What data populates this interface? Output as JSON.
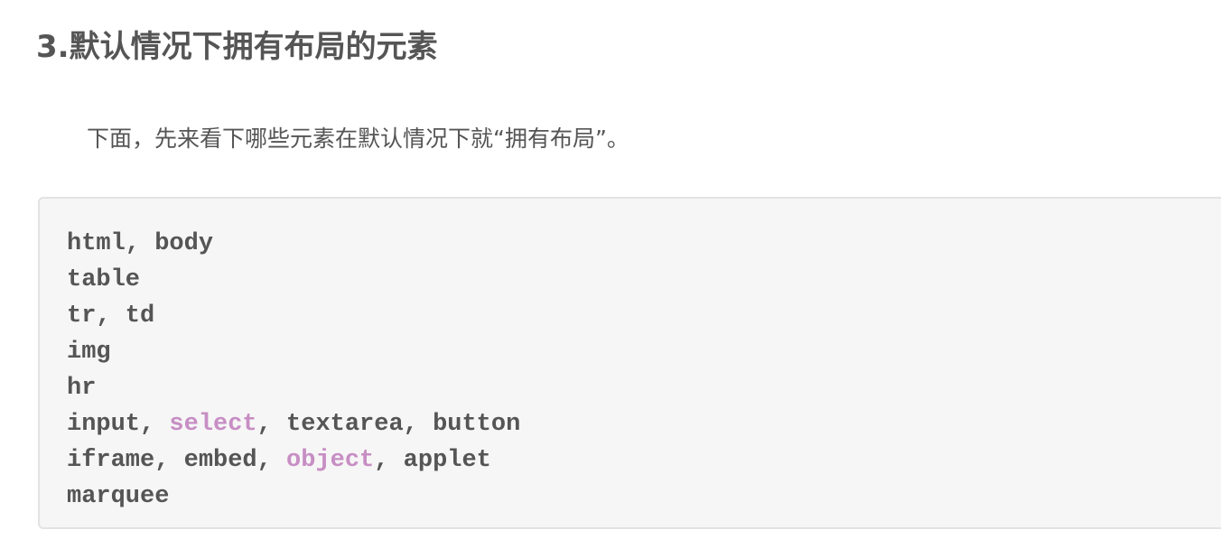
{
  "heading": "3.默认情况下拥有布局的元素",
  "intro": "下面，先来看下哪些元素在默认情况下就“拥有布局”。",
  "code": {
    "line1": "html, body",
    "line2": "table",
    "line3": "tr, td",
    "line4": "img",
    "line5": "hr",
    "line6": {
      "a": "input, ",
      "kw": "select",
      "b": ", textarea, button"
    },
    "line7": {
      "a": "iframe, embed, ",
      "kw": "object",
      "b": ", applet"
    },
    "line8": "marquee"
  },
  "colors": {
    "text": "#555555",
    "keyword": "#c78ec4",
    "code_background": "#f6f6f6",
    "code_border": "#e3e3e3"
  }
}
